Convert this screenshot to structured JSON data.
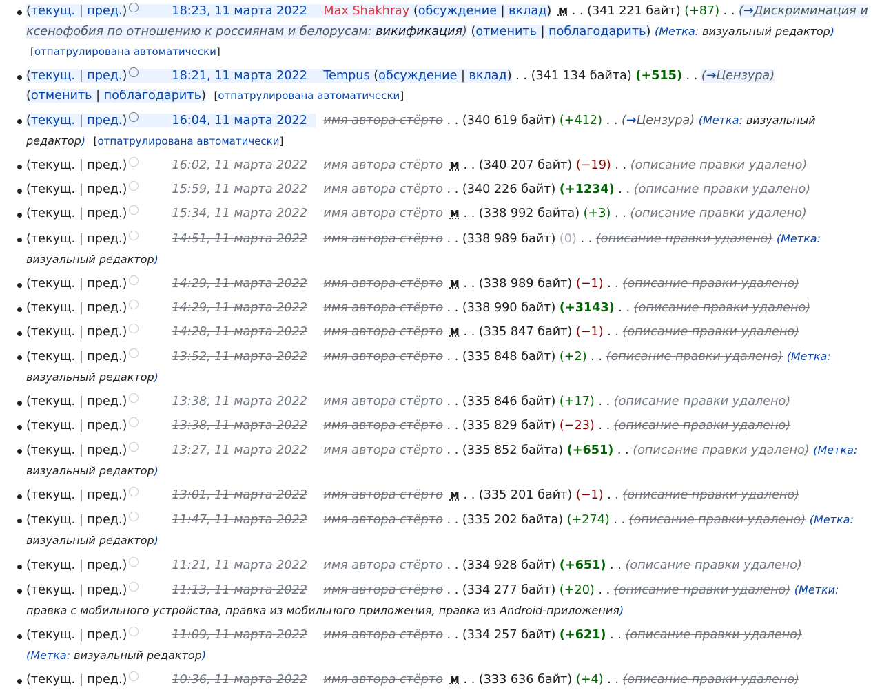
{
  "labels": {
    "cur": "текущ.",
    "prev": "пред.",
    "user_hidden": "имя автора стёрто",
    "summary_hidden": "описание правки удалено",
    "minor": "м",
    "talk": "обсуждение",
    "contribs": "вклад",
    "undo": "отменить",
    "thank": "поблагодарить",
    "tag_label": "Метка:",
    "tags_label": "Метки:",
    "tag_visual": "визуальный редактор",
    "tags_mobile": "правка с мобильного устройства, правка из мобильного приложения, правка из Android-приложения",
    "patrolled": "отпатрулирована автоматически"
  },
  "entries": [
    {
      "time": "18:23, 11 марта 2022",
      "user": "Max Shakhray",
      "size": "341 221 байт",
      "diff": "+87",
      "minor": true,
      "arrow": "Дискриминация и ксенофобия по отношению к россиянам и белорусам:",
      "comment": "викификация",
      "tags": "визуальный редактор"
    },
    {
      "time": "18:21, 11 марта 2022",
      "user": "Tempus",
      "size": "341 134 байта",
      "diff": "+515",
      "arrow": "Цензура"
    },
    {
      "time": "16:04, 11 марта 2022",
      "size": "340 619 байт",
      "diff": "+412",
      "arrow": "Цензура",
      "tags": "визуальный редактор"
    },
    {
      "time": "16:02, 11 марта 2022",
      "size": "340 207 байт",
      "diff": "−19",
      "minor": true
    },
    {
      "time": "15:59, 11 марта 2022",
      "size": "340 226 байт",
      "diff": "+1234"
    },
    {
      "time": "15:34, 11 марта 2022",
      "size": "338 992 байта",
      "diff": "+3",
      "minor": true
    },
    {
      "time": "14:51, 11 марта 2022",
      "size": "338 989 байт",
      "diff": "0",
      "tags": "визуальный редактор"
    },
    {
      "time": "14:29, 11 марта 2022",
      "size": "338 989 байт",
      "diff": "−1",
      "minor": true
    },
    {
      "time": "14:29, 11 марта 2022",
      "size": "338 990 байт",
      "diff": "+3143"
    },
    {
      "time": "14:28, 11 марта 2022",
      "size": "335 847 байт",
      "diff": "−1",
      "minor": true
    },
    {
      "time": "13:52, 11 марта 2022",
      "size": "335 848 байт",
      "diff": "+2",
      "tags": "визуальный редактор"
    },
    {
      "time": "13:38, 11 марта 2022",
      "size": "335 846 байт",
      "diff": "+17"
    },
    {
      "time": "13:38, 11 марта 2022",
      "size": "335 829 байт",
      "diff": "−23"
    },
    {
      "time": "13:27, 11 марта 2022",
      "size": "335 852 байта",
      "diff": "+651",
      "tags": "визуальный редактор"
    },
    {
      "time": "13:01, 11 марта 2022",
      "size": "335 201 байт",
      "diff": "−1",
      "minor": true
    },
    {
      "time": "11:47, 11 марта 2022",
      "size": "335 202 байта",
      "diff": "+274",
      "tags": "визуальный редактор"
    },
    {
      "time": "11:21, 11 марта 2022",
      "size": "334 928 байт",
      "diff": "+651"
    },
    {
      "time": "11:13, 11 марта 2022",
      "size": "334 277 байт",
      "diff": "+20",
      "tags": "правка с мобильного устройства, правка из мобильного приложения, правка из Android-приложения"
    },
    {
      "time": "11:09, 11 марта 2022",
      "size": "334 257 байт",
      "diff": "+621",
      "tags": "визуальный редактор"
    },
    {
      "time": "10:36, 11 марта 2022",
      "size": "333 636 байт",
      "diff": "+4",
      "minor": true
    }
  ]
}
